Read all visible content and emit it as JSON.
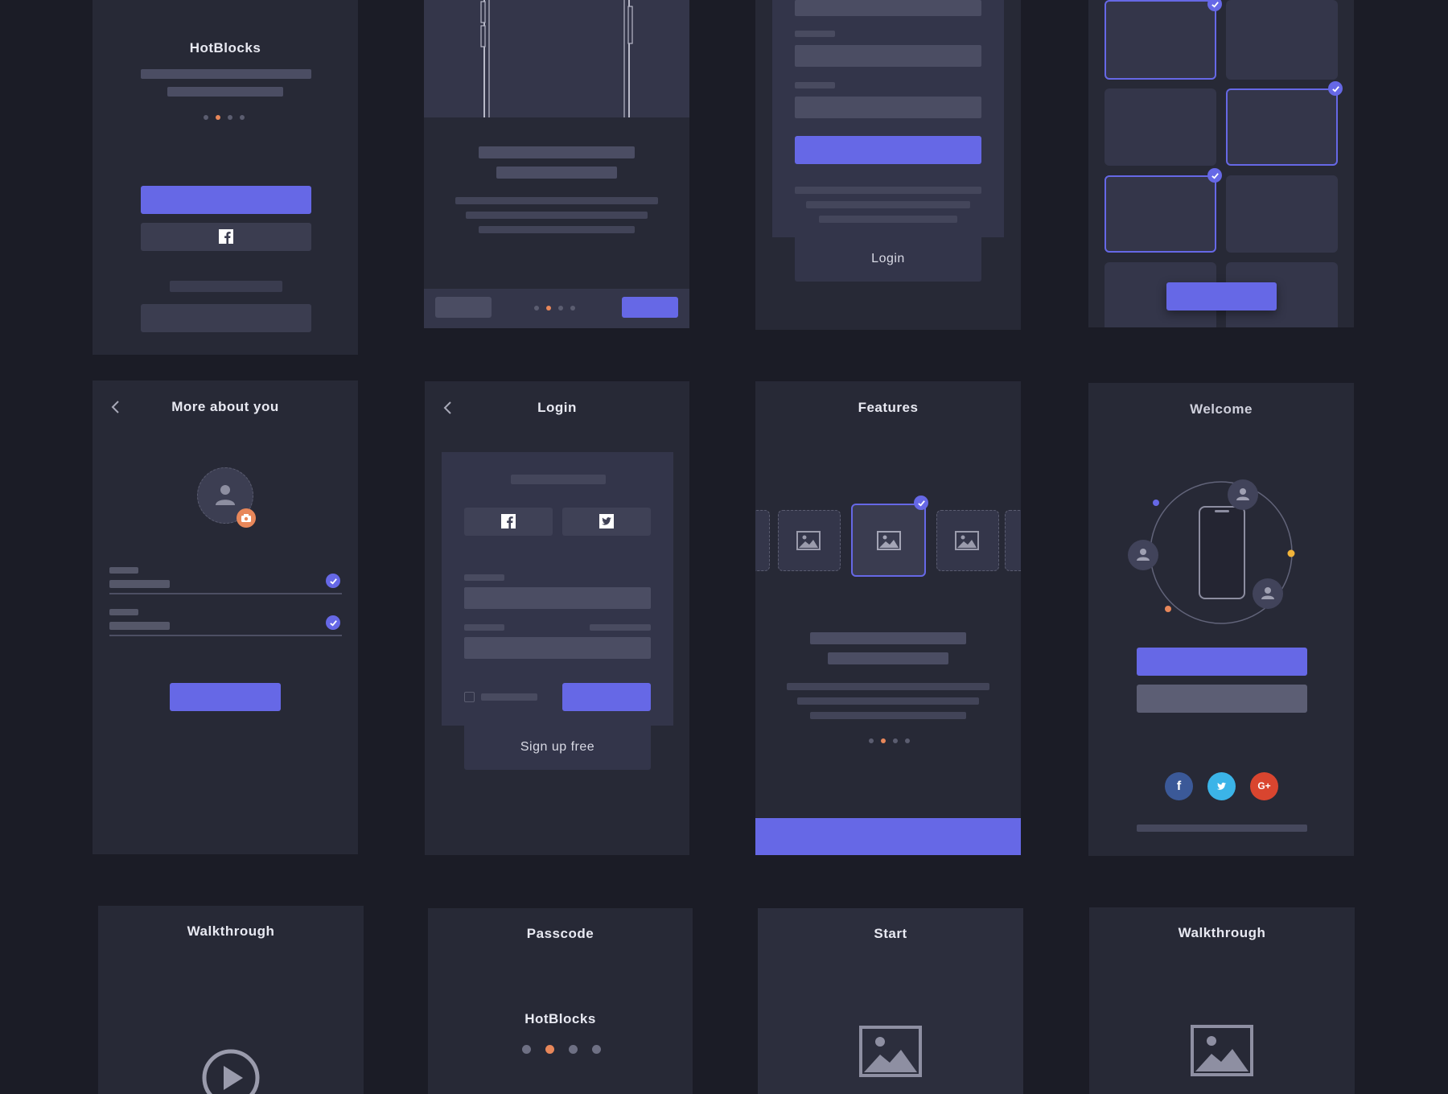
{
  "colors": {
    "background": "#1b1c26",
    "card": "#272936",
    "primary": "#6668e6",
    "accent_dot": "#e8875a",
    "facebook": "#3b5998",
    "twitter": "#3bb4e8",
    "google": "#d9452f"
  },
  "screens": {
    "hotblocks_splash": {
      "brand": "HotBlocks",
      "facebook_icon": "facebook-icon"
    },
    "onboarding_image": {},
    "signup_form": {
      "login_label": "Login"
    },
    "interest_grid": {},
    "more_about_you": {
      "title": "More about you",
      "back_icon": "chevron-left-icon",
      "avatar_icon": "user-icon",
      "camera_icon": "camera-icon"
    },
    "login": {
      "title": "Login",
      "back_icon": "chevron-left-icon",
      "signup_label": "Sign up free"
    },
    "features": {
      "title": "Features"
    },
    "welcome": {
      "title": "Welcome",
      "social": [
        "f",
        "t",
        "G+"
      ]
    },
    "walkthrough_video": {
      "title": "Walkthrough",
      "play_icon": "play-icon"
    },
    "passcode": {
      "title": "Passcode",
      "brand": "HotBlocks"
    },
    "start": {
      "title": "Start",
      "image_icon": "image-icon"
    },
    "walkthrough_image": {
      "title": "Walkthrough",
      "image_icon": "image-icon"
    }
  }
}
